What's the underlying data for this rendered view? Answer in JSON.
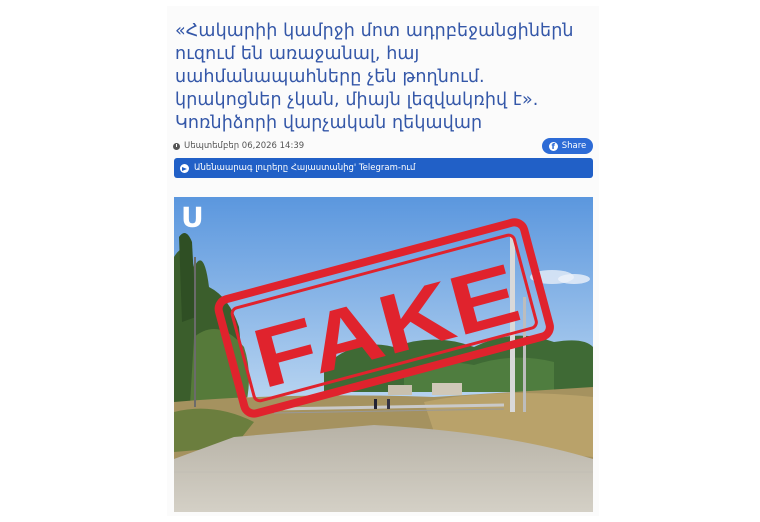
{
  "article": {
    "headline": "«Հակարիի կամրջի մոտ ադրբեջանցիներն ուզում են առաջանալ, հայ սահմանապահները չեն թողնում. կրակոցներ չկան, միայն լեզվակռիվ է». Կոռնիձորի վարչական ղեկավար",
    "date": "Սեպտեմբեր 06,2026 14:39",
    "share_label": "Share",
    "telegram_label": "Անենաարագ լուրերը Հայաստանից' Telegram-ում"
  },
  "photo": {
    "logo_letter": "Ս",
    "stamp_text": "FAKE"
  },
  "colors": {
    "headline": "#3457a8",
    "share_button": "#2d6bd6",
    "telegram_bar": "#2160c7",
    "stamp": "#e0232d"
  },
  "icons": [
    "clock-icon",
    "facebook-icon",
    "telegram-icon"
  ]
}
